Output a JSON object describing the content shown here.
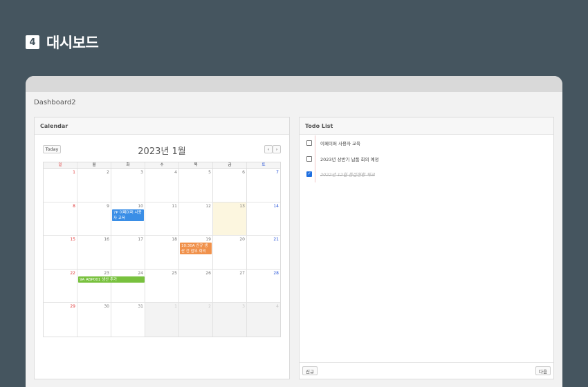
{
  "heading": {
    "number": "4",
    "title": "대시보드"
  },
  "app": {
    "title": "Dashboard2"
  },
  "calendar": {
    "panel_title": "Calendar",
    "today_label": "Today",
    "month": "2023년 1월",
    "prev_label": "‹",
    "next_label": "›",
    "dow": [
      "일",
      "월",
      "화",
      "수",
      "목",
      "금",
      "토"
    ],
    "weeks": [
      [
        "1",
        "2",
        "3",
        "4",
        "5",
        "6",
        "7"
      ],
      [
        "8",
        "9",
        "10",
        "11",
        "12",
        "13",
        "14"
      ],
      [
        "15",
        "16",
        "17",
        "18",
        "19",
        "20",
        "21"
      ],
      [
        "22",
        "23",
        "24",
        "25",
        "26",
        "27",
        "28"
      ],
      [
        "29",
        "30",
        "31",
        "1",
        "2",
        "3",
        "4"
      ]
    ],
    "events": {
      "jan10": "7P 이페이퍼 사용자 교육",
      "jan19": "10:30A 신규 생산 건 업무 회의",
      "jan23": "9A ABP001 생산 추가"
    }
  },
  "todo": {
    "panel_title": "Todo List",
    "items": [
      {
        "text": "이페이퍼 사용자 교육",
        "done": false
      },
      {
        "text": "2023년 상반기 납품 회의 예정",
        "done": false
      },
      {
        "text": "2022년 12월 품질현황 체크",
        "done": true
      }
    ],
    "new_label": "신규",
    "next_label": "다음"
  },
  "colors": {
    "background": "#45555f",
    "event_blue": "#3a8ee6",
    "event_orange": "#f0914b",
    "event_green": "#78c13e",
    "today_highlight": "#fcf6df",
    "sunday": "#e03c3c",
    "saturday": "#2a56d8"
  }
}
